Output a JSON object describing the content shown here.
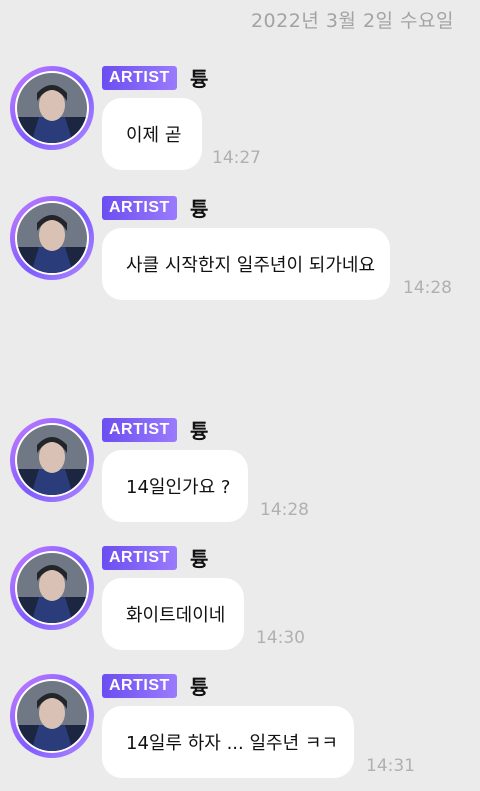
{
  "date": "2022년 3월 2일 수요일",
  "messages": [
    {
      "badge": "ARTIST",
      "name": "튱",
      "text": "이제 곧",
      "time": "14:27"
    },
    {
      "badge": "ARTIST",
      "name": "튱",
      "text": "사클 시작한지 일주년이 되가네요",
      "time": "14:28"
    },
    {
      "badge": "ARTIST",
      "name": "튱",
      "text": "14일인가요 ?",
      "time": "14:28"
    },
    {
      "badge": "ARTIST",
      "name": "튱",
      "text": "화이트데이네",
      "time": "14:30"
    },
    {
      "badge": "ARTIST",
      "name": "튱",
      "text": "14일루 하자 ... 일주년 ㅋㅋ",
      "time": "14:31"
    }
  ],
  "colors": {
    "background": "#ebebeb",
    "badge": "#7b5cf5",
    "bubble": "#ffffff",
    "timestamp": "#b0b0b0"
  },
  "icons": {
    "avatar": "artist-avatar-photo"
  }
}
